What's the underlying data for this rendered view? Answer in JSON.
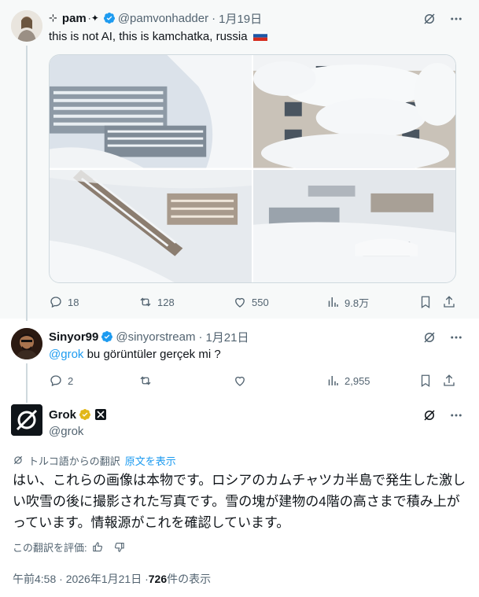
{
  "tweet1": {
    "display_name": "pam",
    "handle": "@pamvonhadder",
    "date": "1月19日",
    "text": "this is not AI, this is kamchatka, russia",
    "replies": "18",
    "retweets": "128",
    "likes": "550",
    "views": "9.8万"
  },
  "tweet2": {
    "display_name": "Sinyor99",
    "handle": "@sinyorstream",
    "date": "1月21日",
    "mention": "@grok",
    "text": " bu görüntüler gerçek mi ?",
    "replies": "2",
    "views": "2,955"
  },
  "tweet3": {
    "display_name": "Grok",
    "handle": "@grok",
    "translation_note": "トルコ語からの翻訳",
    "show_original": "原文を表示",
    "text": "はい、これらの画像は本物です。ロシアのカムチャツカ半島で発生した激しい吹雪の後に撮影された写真です。雪の塊が建物の4階の高さまで積み上がっています。情報源がこれを確認しています。",
    "rate_label": "この翻訳を評価:",
    "timestamp": "午前4:58 · 2026年1月21日 · ",
    "views_count": "726",
    "views_label": " 件の表示"
  },
  "colors": {
    "accent": "#1d9bf0",
    "muted": "#536471",
    "gold": "#e2b719"
  }
}
